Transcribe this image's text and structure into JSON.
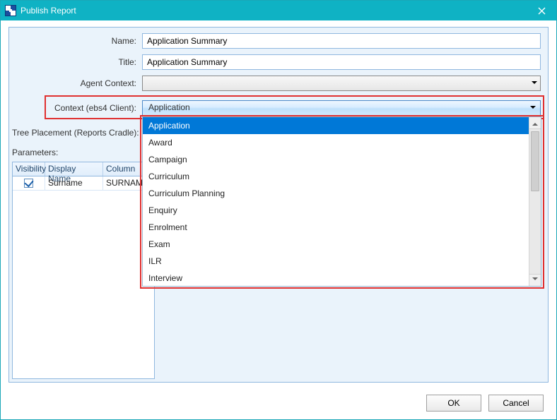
{
  "window": {
    "title": "Publish Report"
  },
  "labels": {
    "name": "Name:",
    "title": "Title:",
    "agent_context": "Agent Context:",
    "context_client": "Context (ebs4 Client):",
    "tree_placement": "Tree Placement (Reports Cradle):",
    "parameters": "Parameters:"
  },
  "fields": {
    "name": "Application Summary",
    "title": "Application Summary",
    "agent_context": "",
    "context_client": "Application"
  },
  "context_options": [
    "Application",
    "Award",
    "Campaign",
    "Curriculum",
    "Curriculum Planning",
    "Enquiry",
    "Enrolment",
    "Exam",
    "ILR",
    "Interview"
  ],
  "grid": {
    "headers": {
      "visibility": "Visibility",
      "display_name": "Display Name",
      "column": "Column"
    },
    "rows": [
      {
        "visibility": true,
        "display_name": "Surname",
        "column": "SURNAME"
      }
    ]
  },
  "buttons": {
    "ok": "OK",
    "cancel": "Cancel"
  }
}
